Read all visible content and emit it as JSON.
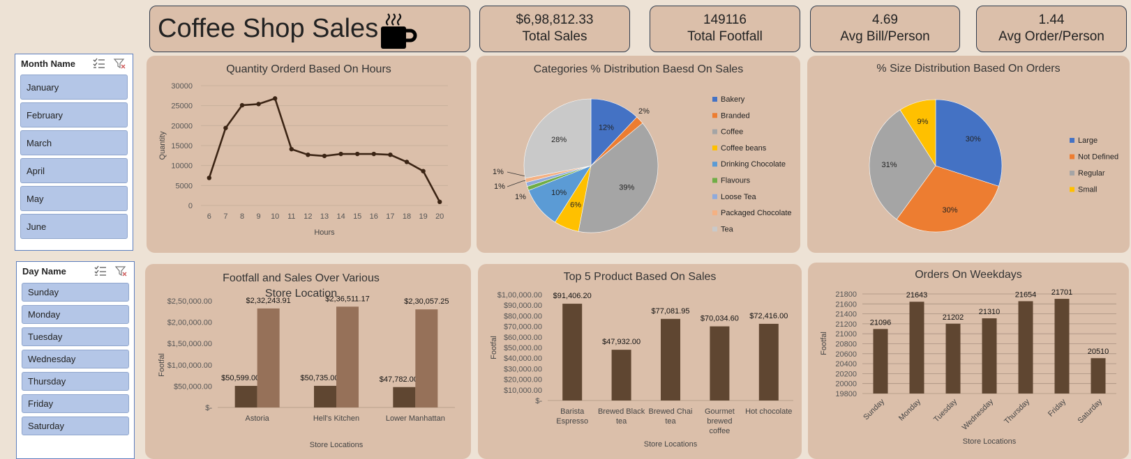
{
  "header": {
    "title": "Coffee Shop Sales",
    "icon": "coffee-cup-icon"
  },
  "kpis": [
    {
      "value": "$6,98,812.33",
      "label": "Total Sales"
    },
    {
      "value": "149116",
      "label": "Total Footfall"
    },
    {
      "value": "4.69",
      "label": "Avg Bill/Person"
    },
    {
      "value": "1.44",
      "label": "Avg Order/Person"
    }
  ],
  "month_slicer": {
    "title": "Month Name",
    "items": [
      "January",
      "February",
      "March",
      "April",
      "May",
      "June"
    ]
  },
  "day_slicer": {
    "title": "Day Name",
    "items": [
      "Sunday",
      "Monday",
      "Tuesday",
      "Wednesday",
      "Thursday",
      "Friday",
      "Saturday"
    ]
  },
  "chart_data": [
    {
      "id": "hours",
      "type": "line",
      "title": "Quantity Orderd Based On Hours",
      "xlabel": "Hours",
      "ylabel": "Quantity",
      "x": [
        6,
        7,
        8,
        9,
        10,
        11,
        12,
        13,
        14,
        15,
        16,
        17,
        18,
        19,
        20
      ],
      "values": [
        6900,
        19400,
        25100,
        25400,
        26800,
        14100,
        12700,
        12400,
        12900,
        12900,
        12900,
        12700,
        10900,
        8600,
        900
      ],
      "ylim": [
        0,
        30000
      ],
      "yticks": [
        "0",
        "5000",
        "10000",
        "15000",
        "20000",
        "25000",
        "30000"
      ],
      "grid": true,
      "color": "#3b2414"
    },
    {
      "id": "categories",
      "type": "pie",
      "title": "Categories % Distribution Baesd On Sales",
      "legend": "right",
      "slices": [
        {
          "name": "Bakery",
          "value": 12,
          "label": "12%",
          "color": "#4472c4"
        },
        {
          "name": "Branded",
          "value": 2,
          "label": "2%",
          "color": "#ed7d31"
        },
        {
          "name": "Coffee",
          "value": 39,
          "label": "39%",
          "color": "#a5a5a5"
        },
        {
          "name": "Coffee beans",
          "value": 6,
          "label": "6%",
          "color": "#ffc000"
        },
        {
          "name": "Drinking Chocolate",
          "value": 10,
          "label": "10%",
          "color": "#5b9bd5"
        },
        {
          "name": "Flavours",
          "value": 1,
          "label": "1%",
          "color": "#70ad47"
        },
        {
          "name": "Loose Tea",
          "value": 1,
          "label": "1%",
          "color": "#8faadc"
        },
        {
          "name": "Packaged Chocolate",
          "value": 1,
          "label": "1%",
          "color": "#f4b183"
        },
        {
          "name": "Tea",
          "value": 28,
          "label": "28%",
          "color": "#c9c9c9"
        }
      ]
    },
    {
      "id": "sizes",
      "type": "pie",
      "title": "% Size Distribution Based On Orders",
      "legend": "right",
      "slices": [
        {
          "name": "Large",
          "value": 30,
          "label": "30%",
          "color": "#4472c4"
        },
        {
          "name": "Not Defined",
          "value": 30,
          "label": "30%",
          "color": "#ed7d31"
        },
        {
          "name": "Regular",
          "value": 31,
          "label": "31%",
          "color": "#a5a5a5"
        },
        {
          "name": "Small",
          "value": 9,
          "label": "9%",
          "color": "#ffc000"
        }
      ]
    },
    {
      "id": "stores",
      "type": "bar",
      "title": "Footfall and Sales Over Various Store Location",
      "xlabel": "Store Locations",
      "ylabel": "Footfal",
      "categories": [
        "Astoria",
        "Hell's Kitchen",
        "Lower Manhattan"
      ],
      "series": [
        {
          "values": [
            50599.0,
            50735.0,
            47782.0
          ],
          "labels": [
            "$50,599.00",
            "$50,735.00",
            "$47,782.00"
          ],
          "color": "#5f4631"
        },
        {
          "values": [
            232243.91,
            236511.17,
            230057.25
          ],
          "labels": [
            "$2,32,243.91",
            "$2,36,511.17",
            "$2,30,057.25"
          ],
          "color": "#967159"
        }
      ],
      "ylim": [
        0,
        250000
      ],
      "yticks": [
        "$-",
        "$50,000.00",
        "$1,00,000.00",
        "$1,50,000.00",
        "$2,00,000.00",
        "$2,50,000.00"
      ],
      "grid": false
    },
    {
      "id": "products",
      "type": "bar",
      "title": "Top 5 Product Based On Sales",
      "xlabel": "Store Locations",
      "ylabel": "Footfal",
      "categories": [
        [
          "Barista",
          "Espresso"
        ],
        [
          "Brewed Black",
          "tea"
        ],
        [
          "Brewed Chai",
          "tea"
        ],
        [
          "Gourmet",
          "brewed",
          "coffee"
        ],
        [
          "Hot chocolate"
        ]
      ],
      "values": [
        91406.2,
        47932.0,
        77081.95,
        70034.6,
        72416.0
      ],
      "labels": [
        "$91,406.20",
        "$47,932.00",
        "$77,081.95",
        "$70,034.60",
        "$72,416.00"
      ],
      "ylim": [
        0,
        100000
      ],
      "yticks": [
        "$-",
        "$10,000.00",
        "$20,000.00",
        "$30,000.00",
        "$40,000.00",
        "$50,000.00",
        "$60,000.00",
        "$70,000.00",
        "$80,000.00",
        "$90,000.00",
        "$1,00,000.00"
      ],
      "color": "#5f4631",
      "grid": false
    },
    {
      "id": "weekdays",
      "type": "bar",
      "title": "Orders On Weekdays",
      "xlabel": "Store Locations",
      "ylabel": "Footfal",
      "categories": [
        "Sunday",
        "Monday",
        "Tuesday",
        "Wednesday",
        "Thursday",
        "Friday",
        "Saturday"
      ],
      "values": [
        21096,
        21643,
        21202,
        21310,
        21654,
        21701,
        20510
      ],
      "labels": [
        "21096",
        "21643",
        "21202",
        "21310",
        "21654",
        "21701",
        "20510"
      ],
      "ylim": [
        19800,
        21800
      ],
      "yticks": [
        "19800",
        "20000",
        "20200",
        "20400",
        "20600",
        "20800",
        "21000",
        "21200",
        "21400",
        "21600",
        "21800"
      ],
      "color": "#5f4631",
      "grid": true
    }
  ]
}
